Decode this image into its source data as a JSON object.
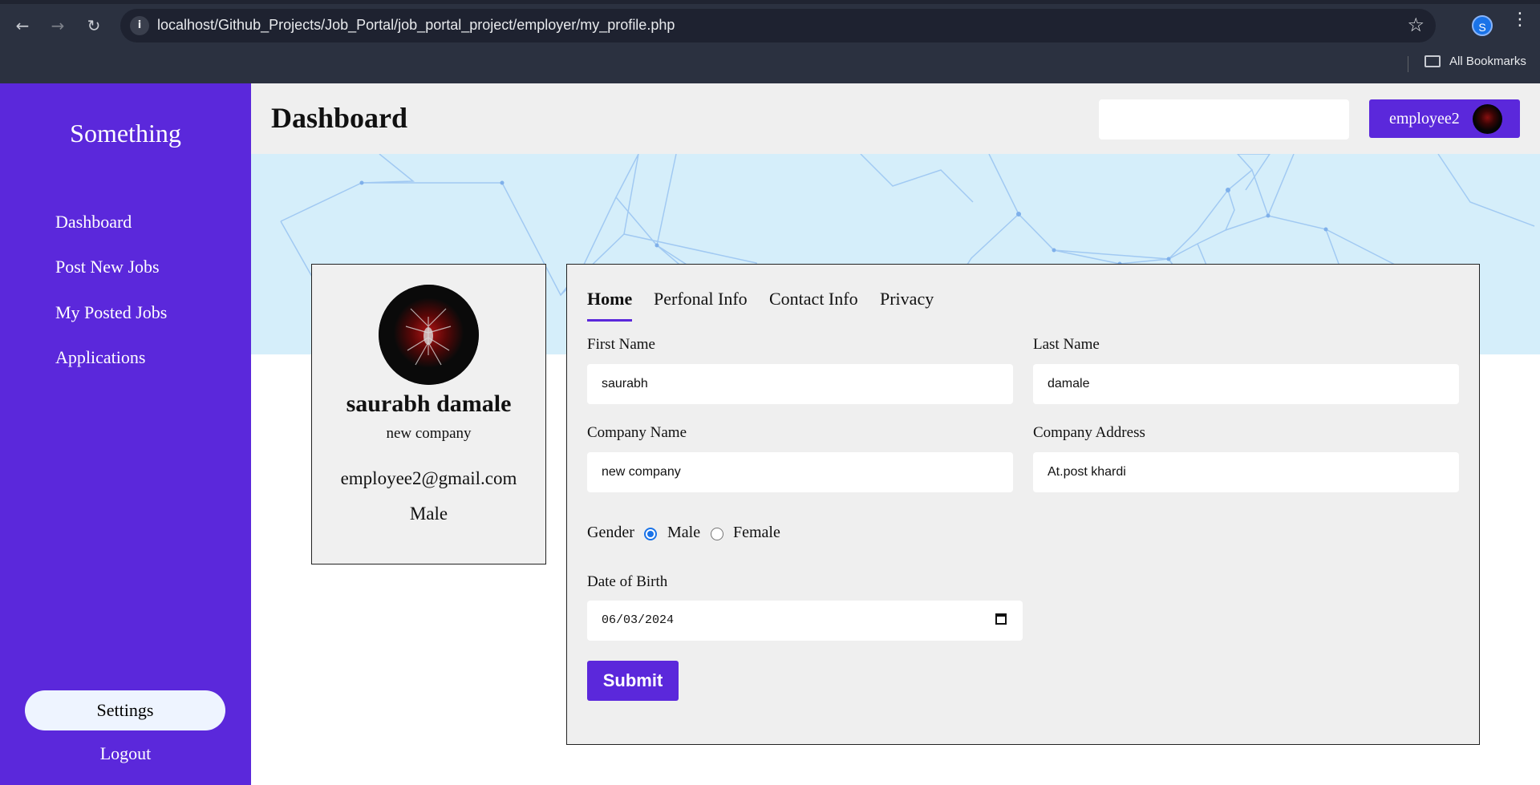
{
  "browser": {
    "url": "localhost/Github_Projects/Job_Portal/job_portal_project/employer/my_profile.php",
    "back_icon": "←",
    "forward_icon": "→",
    "reload_icon": "↻",
    "info_icon": "i",
    "star_icon": "☆",
    "profile_initial": "S",
    "menu_icon": "⋮",
    "bookmarks_label": "All Bookmarks"
  },
  "sidebar": {
    "brand": "Something",
    "items": [
      {
        "label": "Dashboard"
      },
      {
        "label": "Post New Jobs"
      },
      {
        "label": "My Posted Jobs"
      },
      {
        "label": "Applications"
      }
    ],
    "settings_label": "Settings",
    "logout_label": "Logout"
  },
  "header": {
    "title": "Dashboard",
    "search_value": "",
    "user_name": "employee2"
  },
  "profile_card": {
    "name": "saurabh damale",
    "company": "new company",
    "email": "employee2@gmail.com",
    "gender": "Male"
  },
  "form": {
    "tabs": [
      {
        "label": "Home",
        "active": true
      },
      {
        "label": "Perfonal Info",
        "active": false
      },
      {
        "label": "Contact Info",
        "active": false
      },
      {
        "label": "Privacy",
        "active": false
      }
    ],
    "first_name_label": "First Name",
    "first_name_value": "saurabh",
    "last_name_label": "Last Name",
    "last_name_value": "damale",
    "company_name_label": "Company Name",
    "company_name_value": "new company",
    "company_address_label": "Company Address",
    "company_address_value": "At.post khardi",
    "gender_label": "Gender",
    "gender_options": [
      {
        "label": "Male",
        "checked": true
      },
      {
        "label": "Female",
        "checked": false
      }
    ],
    "dob_label": "Date of Birth",
    "dob_value": "06/03/2024",
    "submit_label": "Submit"
  },
  "colors": {
    "accent": "#5b28db",
    "banner": "#d5eefa",
    "panel": "#efefef"
  }
}
